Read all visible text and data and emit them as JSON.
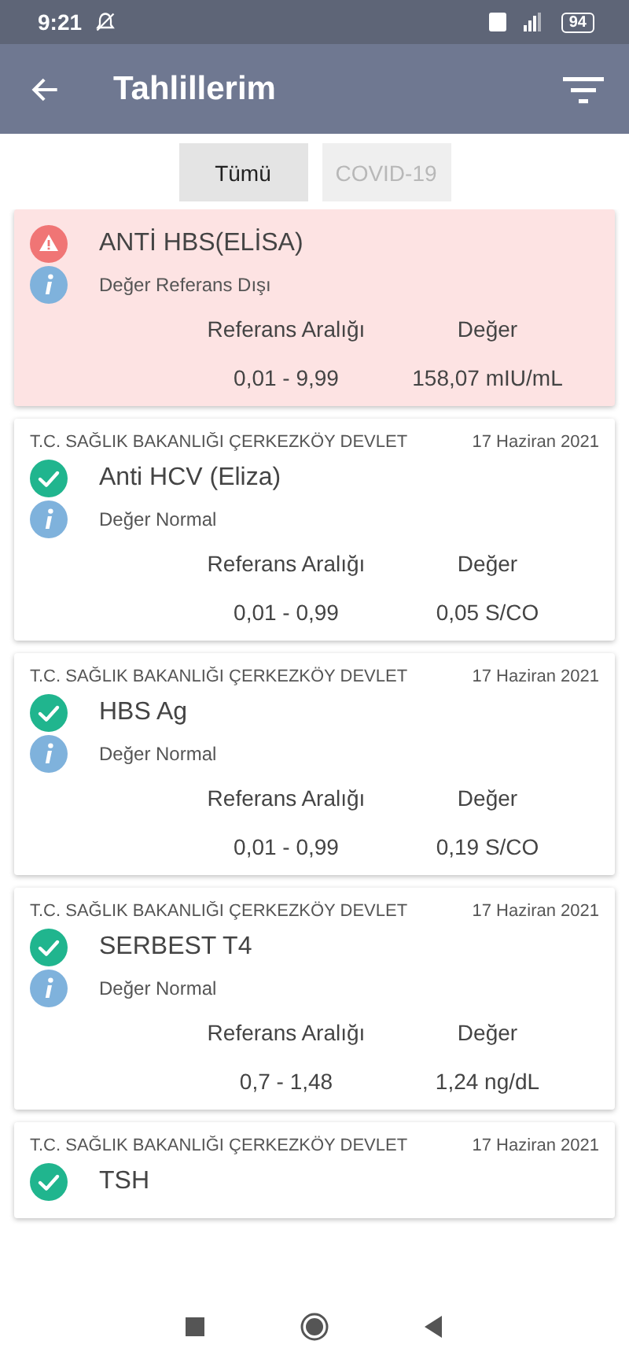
{
  "status_bar": {
    "time": "9:21",
    "battery": "94"
  },
  "app_bar": {
    "title": "Tahlillerim"
  },
  "filters": [
    {
      "label": "Tümü",
      "selected": true
    },
    {
      "label": "COVID-19",
      "selected": false
    }
  ],
  "results": [
    {
      "kind": "abnormal",
      "name": "ANTİ HBS(ELİSA)",
      "note": "Değer Referans Dışı",
      "range_label": "Referans Aralığı",
      "value_label": "Değer",
      "range": "0,01 - 9,99",
      "value": "158,07 mIU/mL"
    },
    {
      "kind": "normal",
      "institution": "T.C. SAĞLIK BAKANLIĞI ÇERKEZKÖY DEVLET",
      "date": "17 Haziran 2021",
      "name": "Anti HCV (Eliza)",
      "note": "Değer Normal",
      "range_label": "Referans Aralığı",
      "value_label": "Değer",
      "range": "0,01 - 0,99",
      "value": "0,05 S/CO"
    },
    {
      "kind": "normal",
      "institution": "T.C. SAĞLIK BAKANLIĞI ÇERKEZKÖY DEVLET",
      "date": "17 Haziran 2021",
      "name": "HBS Ag",
      "note": "Değer Normal",
      "range_label": "Referans Aralığı",
      "value_label": "Değer",
      "range": "0,01 - 0,99",
      "value": "0,19 S/CO"
    },
    {
      "kind": "normal",
      "institution": "T.C. SAĞLIK BAKANLIĞI ÇERKEZKÖY DEVLET",
      "date": "17 Haziran 2021",
      "name": "SERBEST T4",
      "note": "Değer Normal",
      "range_label": "Referans Aralığı",
      "value_label": "Değer",
      "range": "0,7 - 1,48",
      "value": "1,24 ng/dL"
    },
    {
      "kind": "normal",
      "institution": "T.C. SAĞLIK BAKANLIĞI ÇERKEZKÖY DEVLET",
      "date": "17 Haziran 2021",
      "name": "TSH"
    }
  ]
}
